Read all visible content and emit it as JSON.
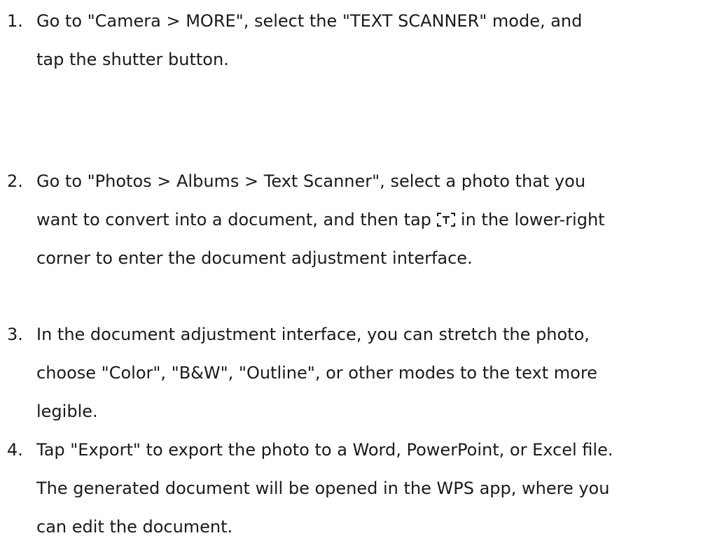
{
  "steps": [
    {
      "number": "1.",
      "lines": [
        "Go to \"Camera > MORE\", select the \"TEXT SCANNER\" mode, and",
        "tap the shutter button."
      ]
    },
    {
      "number": "2.",
      "lines": [
        "Go to \"Photos > Albums > Text Scanner\", select a photo that you",
        "want to convert into a document, and then tap",
        "in the lower-right",
        "corner to enter the document adjustment interface."
      ],
      "inline_icon": "text-scan-icon"
    },
    {
      "number": "3.",
      "lines": [
        "In the document adjustment interface, you can stretch the photo,",
        "choose \"Color\", \"B&W\", \"Outline\", or other modes to the text more",
        "legible."
      ]
    },
    {
      "number": "4.",
      "lines": [
        "Tap \"Export\" to export the photo to a Word, PowerPoint, or Excel file.",
        "The generated document will be opened in the WPS app, where you",
        "can edit the document."
      ]
    }
  ]
}
